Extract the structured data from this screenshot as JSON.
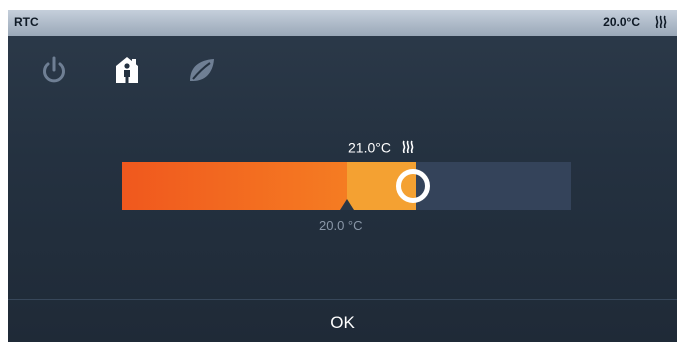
{
  "header": {
    "title": "RTC",
    "current_temp": "20.0°C",
    "heat_icon": "heating-icon"
  },
  "modes": [
    {
      "id": "off",
      "icon": "power-icon",
      "active": false
    },
    {
      "id": "comfort",
      "icon": "home-presence-icon",
      "active": true
    },
    {
      "id": "eco",
      "icon": "leaf-icon",
      "active": false
    }
  ],
  "setpoint": {
    "value": "21.0°C",
    "icon": "heating-icon"
  },
  "slider": {
    "actual_level": 0.5,
    "target_level": 0.655,
    "actual_label": "20.0 °C"
  },
  "footer": {
    "ok_label": "OK"
  },
  "colors": {
    "accent": "#f57c22",
    "fill_start": "#f0581e",
    "target_fill": "#f4a132",
    "background": "#243140"
  }
}
